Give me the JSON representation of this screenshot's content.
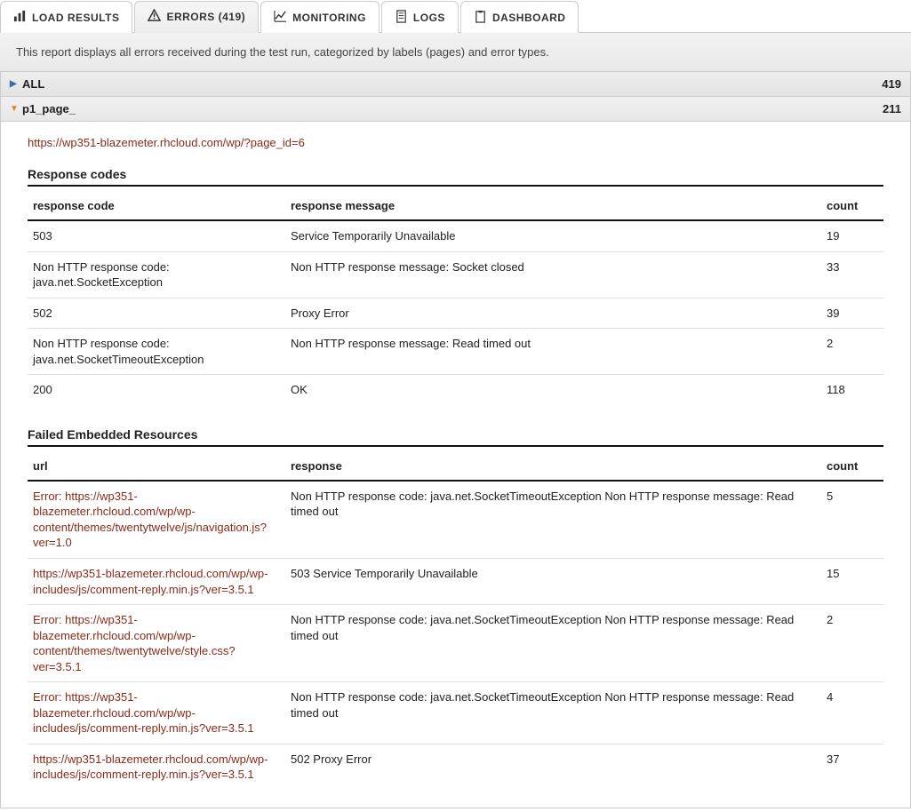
{
  "tabs": {
    "load_results": "LOAD RESULTS",
    "errors": "ERRORS (419)",
    "monitoring": "MONITORING",
    "logs": "LOGS",
    "dashboard": "DASHBOARD"
  },
  "description": "This report displays all errors received during the test run, categorized by labels (pages) and error types.",
  "accordion": {
    "all": {
      "label": "ALL",
      "count": "419"
    },
    "p1": {
      "label": "p1_page_",
      "count": "211"
    }
  },
  "page_url": "https://wp351-blazemeter.rhcloud.com/wp/?page_id=6",
  "response_codes": {
    "title": "Response codes",
    "headers": {
      "code": "response code",
      "message": "response message",
      "count": "count"
    },
    "rows": [
      {
        "code": "503",
        "message": "Service Temporarily Unavailable",
        "count": "19"
      },
      {
        "code": "Non HTTP response code: java.net.SocketException",
        "message": "Non HTTP response message: Socket closed",
        "count": "33"
      },
      {
        "code": "502",
        "message": "Proxy Error",
        "count": "39"
      },
      {
        "code": "Non HTTP response code: java.net.SocketTimeoutException",
        "message": "Non HTTP response message: Read timed out",
        "count": "2"
      },
      {
        "code": "200",
        "message": "OK",
        "count": "118"
      }
    ]
  },
  "failed_resources": {
    "title": "Failed Embedded Resources",
    "headers": {
      "url": "url",
      "response": "response",
      "count": "count"
    },
    "rows": [
      {
        "url": "Error: https://wp351-blazemeter.rhcloud.com/wp/wp-content/themes/twentytwelve/js/navigation.js?ver=1.0",
        "response": "Non HTTP response code: java.net.SocketTimeoutException Non HTTP response message: Read timed out",
        "count": "5"
      },
      {
        "url": "https://wp351-blazemeter.rhcloud.com/wp/wp-includes/js/comment-reply.min.js?ver=3.5.1",
        "response": "503 Service Temporarily Unavailable",
        "count": "15"
      },
      {
        "url": "Error: https://wp351-blazemeter.rhcloud.com/wp/wp-content/themes/twentytwelve/style.css?ver=3.5.1",
        "response": "Non HTTP response code: java.net.SocketTimeoutException Non HTTP response message: Read timed out",
        "count": "2"
      },
      {
        "url": "Error: https://wp351-blazemeter.rhcloud.com/wp/wp-includes/js/comment-reply.min.js?ver=3.5.1",
        "response": "Non HTTP response code: java.net.SocketTimeoutException Non HTTP response message: Read timed out",
        "count": "4"
      },
      {
        "url": "https://wp351-blazemeter.rhcloud.com/wp/wp-includes/js/comment-reply.min.js?ver=3.5.1",
        "response": "502 Proxy Error",
        "count": "37"
      }
    ]
  }
}
